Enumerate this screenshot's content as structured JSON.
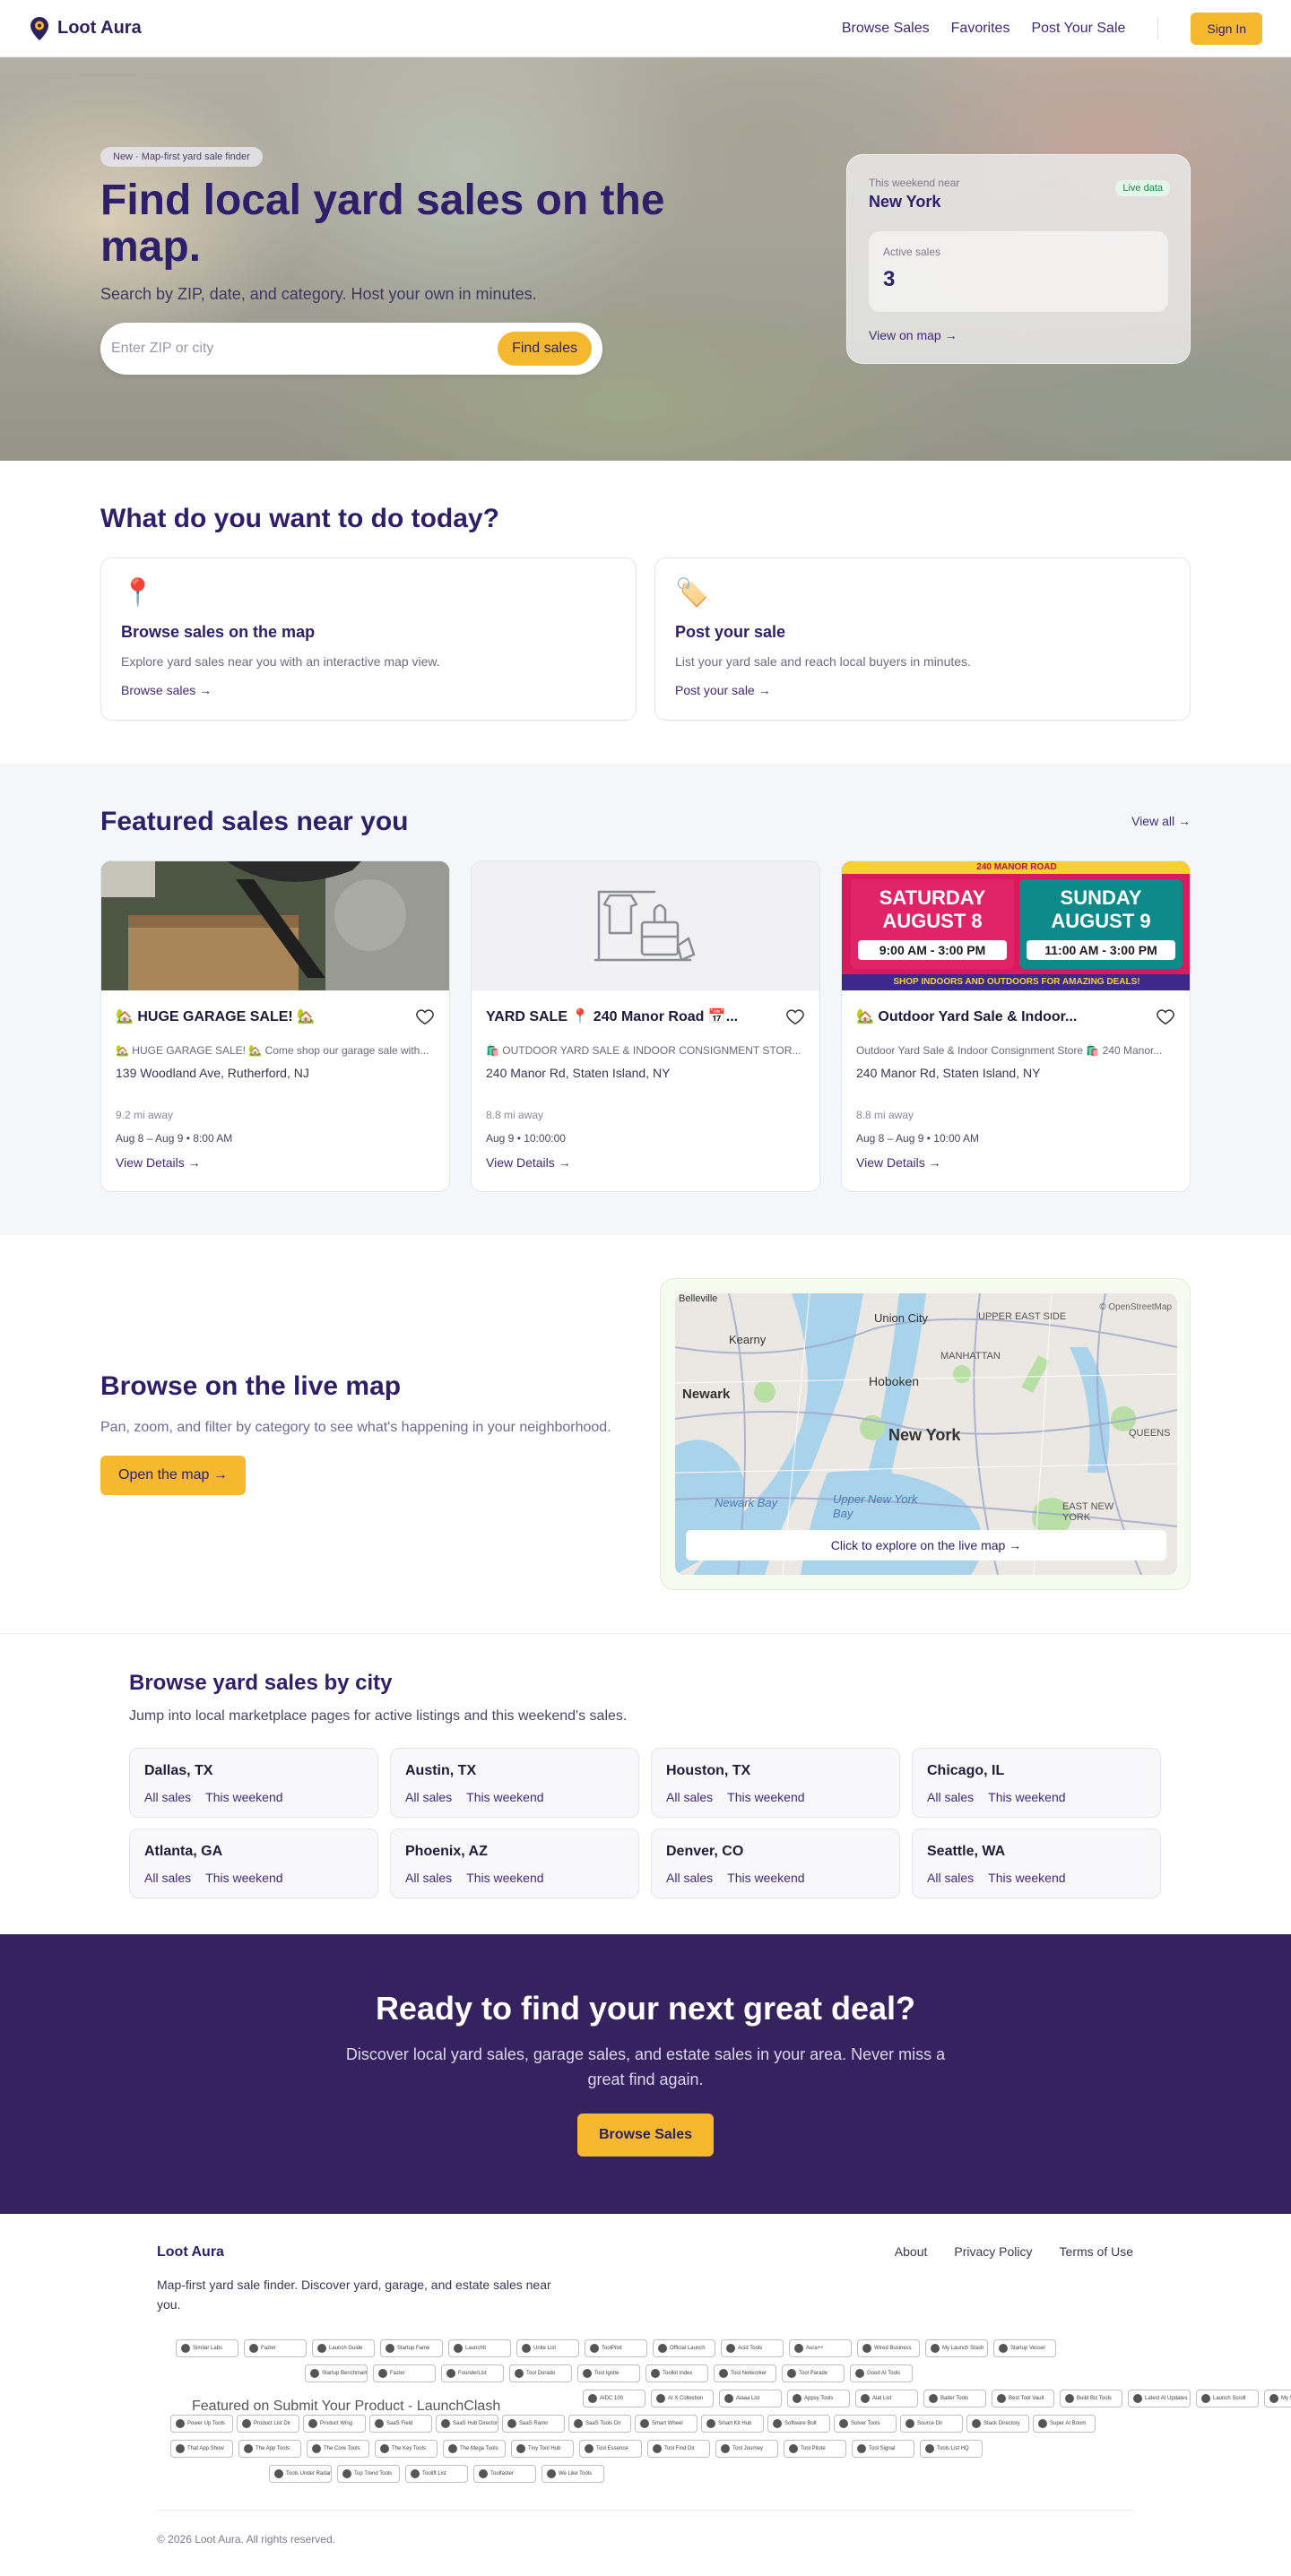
{
  "nav": {
    "brand": "Loot Aura",
    "links": [
      "Browse Sales",
      "Favorites",
      "Post Your Sale"
    ],
    "signin": "Sign In"
  },
  "hero": {
    "badge": "New · Map-first yard sale finder",
    "title": "Find local yard sales on the map.",
    "subtitle": "Search by ZIP, date, and category. Host your own in minutes.",
    "search_placeholder": "Enter ZIP or city",
    "search_button": "Find sales",
    "weekend": {
      "near_label": "This weekend near",
      "city": "New York",
      "live": "Live data",
      "active_label": "Active sales",
      "active_count": "3",
      "link": "View on map →"
    }
  },
  "todo": {
    "title": "What do you want to do today?",
    "cards": [
      {
        "icon": "📍",
        "title": "Browse sales on the map",
        "desc": "Explore yard sales near you with an interactive map view.",
        "link": "Browse sales →"
      },
      {
        "icon": "🏷️",
        "title": "Post your sale",
        "desc": "List your yard sale and reach local buyers in minutes.",
        "link": "Post your sale →"
      }
    ]
  },
  "featured": {
    "title": "Featured sales near you",
    "view_all": "View all →",
    "sales": [
      {
        "title": "🏡 HUGE GARAGE SALE! 🏡",
        "desc": "🏡 HUGE GARAGE SALE! 🏡 Come shop our garage sale with...",
        "address": "139 Woodland Ave, Rutherford, NJ",
        "distance": "9.2 mi away",
        "date": "Aug 8 – Aug 9 • 8:00 AM",
        "link": "View Details →"
      },
      {
        "title": "YARD SALE 📍 240 Manor Road 📅...",
        "desc": "🛍️ OUTDOOR YARD SALE & INDOOR CONSIGNMENT STOR...",
        "address": "240 Manor Rd, Staten Island, NY",
        "distance": "8.8 mi away",
        "date": "Aug 9 • 10:00:00",
        "link": "View Details →"
      },
      {
        "title": "🏡 Outdoor Yard Sale & Indoor...",
        "desc": "Outdoor Yard Sale & Indoor Consignment Store 🛍️ 240 Manor...",
        "address": "240 Manor Rd, Staten Island, NY",
        "distance": "8.8 mi away",
        "date": "Aug 8 – Aug 9 • 10:00 AM",
        "link": "View Details →"
      }
    ],
    "poster": {
      "sat": "SATURDAY",
      "sat_date": "AUGUST 8",
      "sat_time": "9:00 AM - 3:00 PM",
      "sun": "SUNDAY",
      "sun_date": "AUGUST 9",
      "sun_time": "11:00 AM - 3:00 PM",
      "banner": "SHOP INDOORS AND OUTDOORS FOR AMAZING DEALS!",
      "top": "240 MANOR ROAD"
    }
  },
  "live_map": {
    "title": "Browse on the live map",
    "subtitle": "Pan, zoom, and filter by category to see what's happening in your neighborhood.",
    "button": "Open the map →",
    "cta": "Click to explore on the live map →",
    "attribution": "© OpenStreetMap",
    "labels": [
      "Union City",
      "UPPER EAST SIDE",
      "MANHATTAN",
      "Kearny",
      "Hoboken",
      "Newark",
      "New York",
      "QUEENS",
      "Newark Bay",
      "Upper New York Bay",
      "EAST NEW YORK",
      "Belleville"
    ]
  },
  "cities": {
    "title": "Browse yard sales by city",
    "subtitle": "Jump into local marketplace pages for active listings and this weekend's sales.",
    "all_label": "All sales",
    "weekend_label": "This weekend",
    "items": [
      "Dallas, TX",
      "Austin, TX",
      "Houston, TX",
      "Chicago, IL",
      "Atlanta, GA",
      "Phoenix, AZ",
      "Denver, CO",
      "Seattle, WA"
    ]
  },
  "cta": {
    "title": "Ready to find your next great deal?",
    "subtitle": "Discover local yard sales, garage sales, and estate sales in your area. Never miss a great find again.",
    "button": "Browse Sales"
  },
  "footer": {
    "brand": "Loot Aura",
    "desc": "Map-first yard sale finder. Discover yard, garage, and estate sales near you.",
    "links": [
      "About",
      "Privacy Policy",
      "Terms of Use"
    ],
    "broken_badge": "Featured on Submit Your Product - LaunchClash",
    "badges": [
      "Similar Labs",
      "Fazier",
      "Launch Guide",
      "Startup Fame",
      "LaunchIt",
      "Unite List",
      "ToolPilot",
      "Official Launch",
      "Acid Tools",
      "Aura++",
      "Wired Business",
      "My Launch Stash",
      "Startup Vessel",
      "Startup Benchmarks",
      "Fazier",
      "FounderList",
      "Tool Dorado",
      "Tool Ignite",
      "Toolkit Index",
      "Tool Networker",
      "Tool Parade",
      "Good AI Tools",
      "AIDC 100",
      "AI X Collection",
      "Aiaaa List",
      "Appsy Tools",
      "Aiat List",
      "Baiter Tools",
      "Best Tool Vault",
      "Build Biz Tools",
      "Latest AI Updates",
      "Launch Scroll",
      "My Start Tools",
      "Power Up Tools",
      "Product List Dir",
      "Product Wing",
      "SaaS Field",
      "SaaS Hub Directory",
      "SaaS Rankr",
      "SaaS Tools Dir",
      "Smart Wheel",
      "Smart Kit Hub",
      "Software Bolt",
      "Solver Tools",
      "Source Dir",
      "Stack Directory",
      "Super AI Boom",
      "That App Show",
      "The App Tools",
      "The Core Tools",
      "The Key Tools",
      "The Mega Tools",
      "Tiny Tool Hub",
      "Tool Essence",
      "Tool Find Dir",
      "Tool Journey",
      "Tool Pilote",
      "Tool Signal",
      "Tools List HQ",
      "Tools Under Radar",
      "Top Trend Tools",
      "Toolift List",
      "Toolfaster",
      "We Like Tools"
    ],
    "copyright": "© 2026 Loot Aura. All rights reserved."
  }
}
